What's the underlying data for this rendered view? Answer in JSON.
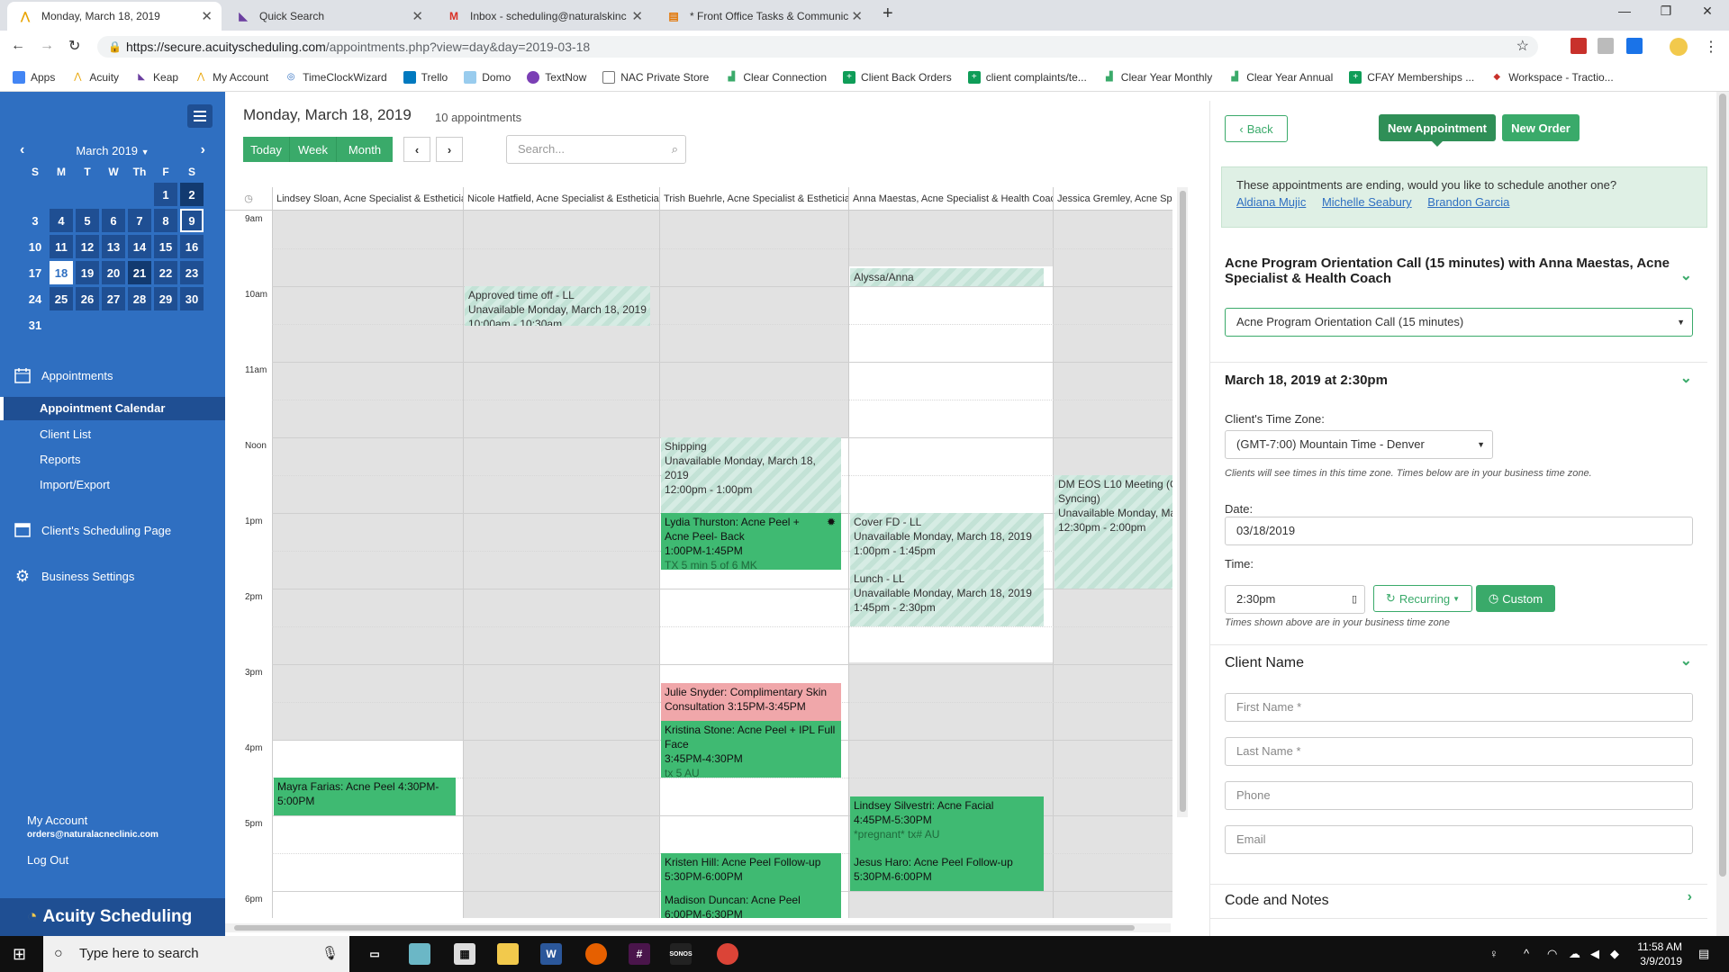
{
  "browser": {
    "tabs": [
      {
        "title": "Monday, March 18, 2019",
        "active": true
      },
      {
        "title": "Quick Search"
      },
      {
        "title": "Inbox - scheduling@naturalskinc"
      },
      {
        "title": "* Front Office Tasks & Communic"
      }
    ],
    "new_tab": "+",
    "url_host": "https://secure.acuityscheduling.com",
    "url_path": "/appointments.php?view=day&day=2019-03-18",
    "bookmarks": [
      "Apps",
      "Acuity",
      "Keap",
      "My Account",
      "TimeClockWizard",
      "Trello",
      "Domo",
      "TextNow",
      "NAC Private Store",
      "Clear Connection",
      "Client Back Orders",
      "client complaints/te...",
      "Clear Year Monthly",
      "Clear Year Annual",
      "CFAY Memberships ...",
      "Workspace - Tractio..."
    ]
  },
  "sidebar": {
    "month_label": "March 2019",
    "dow": [
      "S",
      "M",
      "T",
      "W",
      "Th",
      "F",
      "S"
    ],
    "days": [
      "",
      "",
      "",
      "",
      "",
      "1",
      "2",
      "3",
      "4",
      "5",
      "6",
      "7",
      "8",
      "9",
      "10",
      "11",
      "12",
      "13",
      "14",
      "15",
      "16",
      "17",
      "18",
      "19",
      "20",
      "21",
      "22",
      "23",
      "24",
      "25",
      "26",
      "27",
      "28",
      "29",
      "30",
      "31"
    ],
    "nav": {
      "appointments": "Appointments",
      "appointment_calendar": "Appointment Calendar",
      "client_list": "Client List",
      "reports": "Reports",
      "import_export": "Import/Export",
      "scheduling_page": "Client's Scheduling Page",
      "business_settings": "Business Settings"
    },
    "account_label": "My Account",
    "account_email": "orders@naturalacneclinic.com",
    "logout": "Log Out",
    "brand": "Acuity Scheduling"
  },
  "main": {
    "date_title": "Monday, March 18, 2019",
    "count": "10 appointments",
    "view_today": "Today",
    "view_week": "Week",
    "view_month": "Month",
    "search_placeholder": "Search...",
    "columns": [
      "Lindsey Sloan, Acne Specialist & Esthetician",
      "Nicole Hatfield, Acne Specialist & Esthetician",
      "Trish Buehrle, Acne Specialist & Esthetician",
      "Anna Maestas, Acne Specialist & Health Coach",
      "Jessica Gremley, Acne Spec"
    ],
    "times": [
      "9am",
      "10am",
      "11am",
      "Noon",
      "1pm",
      "2pm",
      "3pm",
      "4pm",
      "5pm",
      "6pm"
    ],
    "events": {
      "alyssa": "Alyssa/Anna",
      "timeoff_t": "Approved time off - LL",
      "timeoff_s": "Unavailable Monday, March 18, 2019",
      "timeoff_r": "10:00am - 10:30am",
      "shipping_t": "Shipping",
      "shipping_s": "Unavailable Monday, March 18, 2019",
      "shipping_r": "12:00pm - 1:00pm",
      "dm_t": "DM EOS L10 Meeting (Go",
      "dm_t2": "Syncing)",
      "dm_s": "Unavailable Monday, Mar",
      "dm_r": "12:30pm - 2:00pm",
      "lydia_t": "Lydia Thurston:  Acne Peel +",
      "lydia_t2": "Acne Peel- Back",
      "lydia_r": "1:00PM-1:45PM",
      "lydia_n": "TX 5 min 5 of 6 MK",
      "coverfd_t": "Cover FD - LL",
      "coverfd_s": "Unavailable Monday, March 18, 2019",
      "coverfd_r": "1:00pm - 1:45pm",
      "lunch_t": "Lunch - LL",
      "lunch_s": "Unavailable Monday, March 18, 2019",
      "lunch_r": "1:45pm - 2:30pm",
      "julie_t": "Julie Snyder:  Complimentary Skin",
      "julie_t2": "Consultation  3:15PM-3:45PM",
      "kristina_t": "Kristina Stone:  Acne Peel + IPL Full",
      "kristina_t2": "Face",
      "kristina_r": "3:45PM-4:30PM",
      "kristina_n": "tx 5 AU",
      "mayra_t": "Mayra Farias:  Acne Peel  4:30PM-",
      "mayra_t2": "5:00PM",
      "lindseys_t": "Lindsey Silvestri:  Acne Facial",
      "lindseys_r": "4:45PM-5:30PM",
      "lindseys_n": "*pregnant* tx# AU",
      "kristen_t": "Kristen Hill:  Acne Peel Follow-up",
      "kristen_r": "5:30PM-6:00PM",
      "jesus_t": "Jesus Haro:  Acne Peel Follow-up",
      "jesus_r": "5:30PM-6:00PM",
      "madison_t": "Madison Duncan:  Acne Peel",
      "madison_r": "6:00PM-6:30PM"
    }
  },
  "panel": {
    "back": "Back",
    "new_appointment": "New Appointment",
    "new_order": "New Order",
    "notice": "These appointments are ending, would you like to schedule another one?",
    "notice_links": [
      "Aldiana Mujic",
      "Michelle Seabury",
      "Brandon Garcia"
    ],
    "appt_title": "Acne Program Orientation Call (15 minutes) with Anna Maestas, Acne Specialist & Health Coach",
    "appt_type": "Acne Program Orientation Call (15 minutes)",
    "datetime_title": "March 18, 2019 at 2:30pm",
    "tz_label": "Client's Time Zone:",
    "tz_value": "(GMT-7:00) Mountain Time - Denver",
    "tz_hint": "Clients will see times in this time zone. Times below are in your business time zone.",
    "date_label": "Date:",
    "date_value": "03/18/2019",
    "time_label": "Time:",
    "time_value": "2:30pm",
    "recurring": "Recurring",
    "custom": "Custom",
    "time_hint": "Times shown above are in your business time zone",
    "client_name": "Client Name",
    "first_name": "First Name *",
    "last_name": "Last Name *",
    "phone": "Phone",
    "email": "Email",
    "code_notes": "Code and Notes"
  },
  "taskbar": {
    "search": "Type here to search",
    "time": "11:58 AM",
    "date": "3/9/2019"
  }
}
